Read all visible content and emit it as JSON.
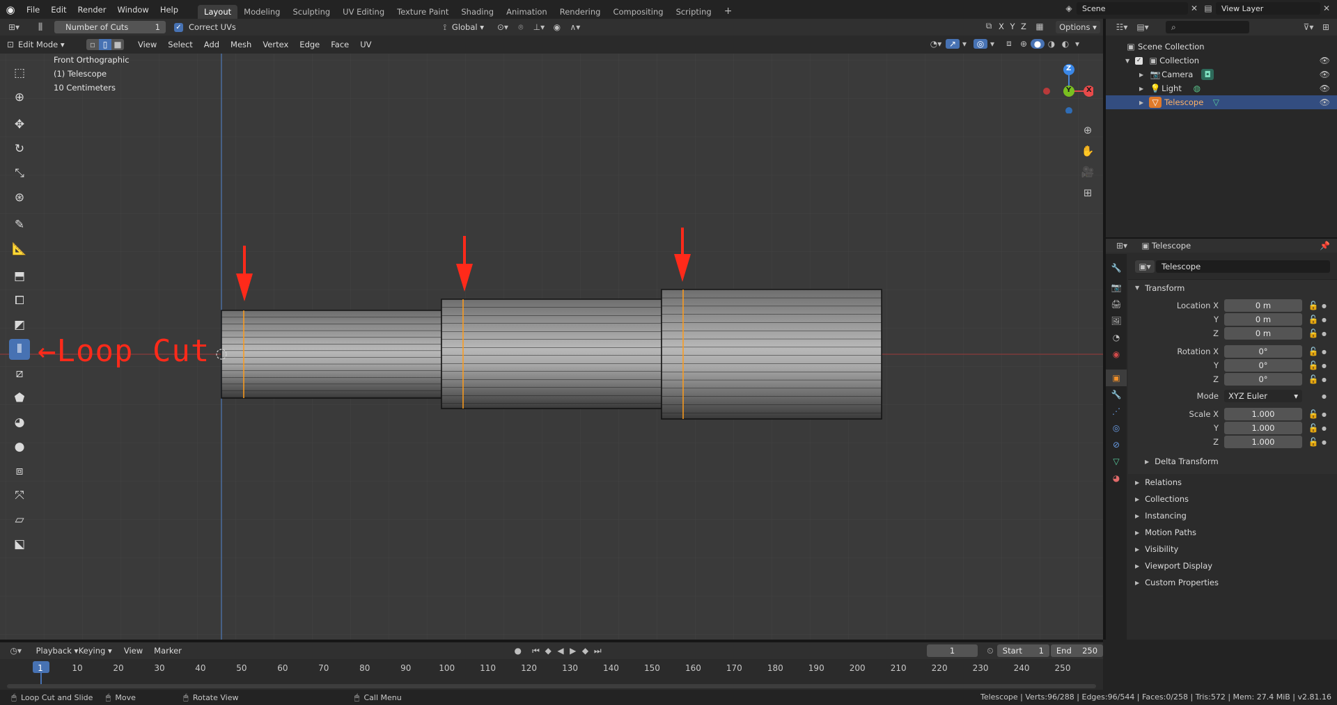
{
  "menu": {
    "logo": "blender-logo",
    "items": [
      "File",
      "Edit",
      "Render",
      "Window",
      "Help"
    ]
  },
  "workspaces": [
    "Layout",
    "Modeling",
    "Sculpting",
    "UV Editing",
    "Texture Paint",
    "Shading",
    "Animation",
    "Rendering",
    "Compositing",
    "Scripting"
  ],
  "scene": {
    "label": "Scene",
    "view_layer": "View Layer"
  },
  "tool_settings": {
    "number_of_cuts_label": "Number of Cuts",
    "number_of_cuts_value": "1",
    "correct_uvs_label": "Correct UVs",
    "correct_uvs_checked": true,
    "transform_orientation": "Global",
    "axis": [
      "X",
      "Y",
      "Z"
    ],
    "options": "Options"
  },
  "viewport_header": {
    "mode": "Edit Mode",
    "menus": [
      "View",
      "Select",
      "Add",
      "Mesh",
      "Vertex",
      "Edge",
      "Face",
      "UV"
    ]
  },
  "viewport_info": {
    "view": "Front Orthographic",
    "object": "(1) Telescope",
    "scale": "10 Centimeters"
  },
  "annotation": {
    "text": "←Loop Cut",
    "color": "#ff2a1a"
  },
  "gizmo": {
    "z": "Z",
    "y": "Y",
    "x": "X"
  },
  "outliner": {
    "root": "Scene Collection",
    "collection": "Collection",
    "items": [
      {
        "name": "Camera",
        "icon": "camera-icon"
      },
      {
        "name": "Light",
        "icon": "light-icon"
      },
      {
        "name": "Telescope",
        "icon": "mesh-icon",
        "selected": true
      }
    ]
  },
  "properties": {
    "header": "Telescope",
    "object_name": "Telescope",
    "transform_label": "Transform",
    "location": {
      "label": "Location X",
      "x": "0 m",
      "y": "0 m",
      "z": "0 m"
    },
    "rotation": {
      "label": "Rotation X",
      "x": "0°",
      "y": "0°",
      "z": "0°"
    },
    "mode": {
      "label": "Mode",
      "value": "XYZ Euler"
    },
    "scale": {
      "label": "Scale X",
      "x": "1.000",
      "y": "1.000",
      "z": "1.000"
    },
    "axis_y": "Y",
    "axis_z": "Z",
    "delta": "Delta Transform",
    "panels": [
      "Relations",
      "Collections",
      "Instancing",
      "Motion Paths",
      "Visibility",
      "Viewport Display",
      "Custom Properties"
    ]
  },
  "timeline": {
    "menus": [
      "Playback",
      "Keying",
      "View",
      "Marker"
    ],
    "current": "1",
    "start_label": "Start",
    "start": "1",
    "end_label": "End",
    "end": "250",
    "ticks": [
      "1",
      "10",
      "20",
      "30",
      "40",
      "50",
      "60",
      "70",
      "80",
      "90",
      "100",
      "110",
      "120",
      "130",
      "140",
      "150",
      "160",
      "170",
      "180",
      "190",
      "200",
      "210",
      "220",
      "230",
      "240",
      "250"
    ]
  },
  "status": {
    "hint1": "Loop Cut and Slide",
    "hint2": "Move",
    "hint3": "Rotate View",
    "hint4": "Call Menu",
    "stats": "Telescope | Verts:96/288 | Edges:96/544 | Faces:0/258 | Tris:572 | Mem: 27.4 MiB | v2.81.16"
  }
}
